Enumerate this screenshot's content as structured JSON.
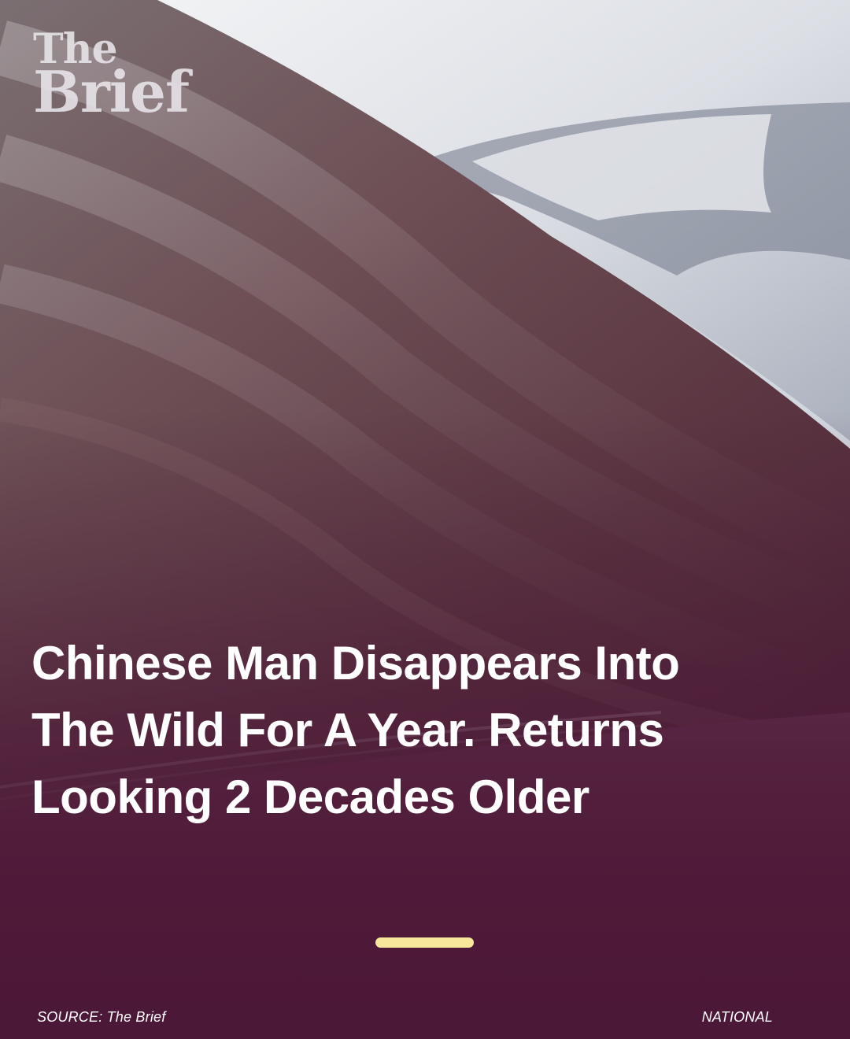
{
  "brand": {
    "logo_line1": "The",
    "logo_line2": "Brief"
  },
  "article": {
    "headline": "Chinese Man Disappears Into The Wild For A Year. Returns Looking 2 Decades Older",
    "category": "NATIONAL"
  },
  "footer": {
    "source": "SOURCE: The Brief"
  },
  "colors": {
    "overlay": "#4a1a36",
    "accent_bar": "#f7e79a",
    "text": "#ffffff"
  }
}
